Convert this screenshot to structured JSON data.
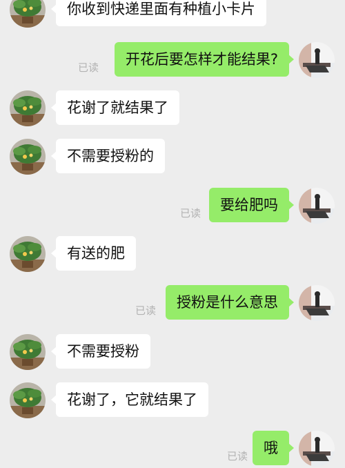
{
  "colors": {
    "background": "#ededed",
    "incoming_bubble": "#ffffff",
    "outgoing_bubble": "#95ec69",
    "read_receipt": "#b2b2b2"
  },
  "messages": [
    {
      "side": "in",
      "text": "你收到快递里面有种植小卡片"
    },
    {
      "side": "out",
      "text": "开花后要怎样才能结果?",
      "read": "已读"
    },
    {
      "side": "in",
      "text": "花谢了就结果了"
    },
    {
      "side": "in",
      "text": "不需要授粉的"
    },
    {
      "side": "out",
      "text": "要给肥吗",
      "read": "已读"
    },
    {
      "side": "in",
      "text": "有送的肥"
    },
    {
      "side": "out",
      "text": "授粉是什么意思",
      "read": "已读"
    },
    {
      "side": "in",
      "text": "不需要授粉"
    },
    {
      "side": "in",
      "text": "花谢了，它就结果了"
    },
    {
      "side": "out",
      "text": "哦",
      "read": "已读"
    }
  ]
}
